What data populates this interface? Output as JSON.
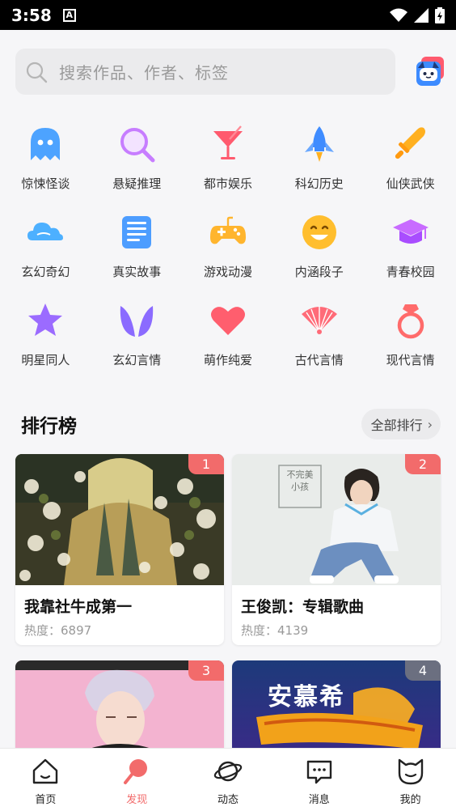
{
  "status_bar": {
    "time": "3:58",
    "notification_letter": "A"
  },
  "search": {
    "placeholder": "搜索作品、作者、标签"
  },
  "categories": [
    {
      "label": "惊悚怪谈",
      "icon": "ghost-icon",
      "color": "#4da3ff"
    },
    {
      "label": "悬疑推理",
      "icon": "magnifier-icon",
      "color": "#c77dff"
    },
    {
      "label": "都市娱乐",
      "icon": "cocktail-icon",
      "color": "#ff5a6e"
    },
    {
      "label": "科幻历史",
      "icon": "rocket-icon",
      "color": "#3f8cff"
    },
    {
      "label": "仙侠武侠",
      "icon": "sword-icon",
      "color": "#ffb020"
    },
    {
      "label": "玄幻奇幻",
      "icon": "cloud-icon",
      "color": "#4db0ff"
    },
    {
      "label": "真实故事",
      "icon": "newspaper-icon",
      "color": "#4d9dff"
    },
    {
      "label": "游戏动漫",
      "icon": "gamepad-icon",
      "color": "#ffb52e"
    },
    {
      "label": "内涵段子",
      "icon": "smiley-icon",
      "color": "#ffbe2e"
    },
    {
      "label": "青春校园",
      "icon": "graduation-cap-icon",
      "color": "#c86bff"
    },
    {
      "label": "明星同人",
      "icon": "star-icon",
      "color": "#9b6bff"
    },
    {
      "label": "玄幻言情",
      "icon": "wings-icon",
      "color": "#8b6bff"
    },
    {
      "label": "萌作纯爱",
      "icon": "heart-icon",
      "color": "#ff5e6e"
    },
    {
      "label": "古代言情",
      "icon": "folding-fan-icon",
      "color": "#ff6b78"
    },
    {
      "label": "现代言情",
      "icon": "ring-icon",
      "color": "#ff6b6b"
    }
  ],
  "ranking": {
    "title": "排行榜",
    "all_label": "全部排行",
    "items": [
      {
        "rank": "1",
        "title": "我靠社牛成第一",
        "heat": "热度：6897",
        "badge_color": "#f26b6b"
      },
      {
        "rank": "2",
        "title": "王俊凯：专辑歌曲",
        "heat": "热度：4139",
        "badge_color": "#f26b6b"
      },
      {
        "rank": "3",
        "title": "",
        "heat": "",
        "badge_color": "#f26b6b"
      },
      {
        "rank": "4",
        "title": "",
        "heat": "",
        "badge_color": "#6b6f80"
      }
    ],
    "card2_sign": [
      "不完美",
      "小孩"
    ],
    "card4_sign": "安慕希"
  },
  "bottom_nav": [
    {
      "label": "首页",
      "icon": "home-icon"
    },
    {
      "label": "发现",
      "icon": "discover-icon",
      "active": true
    },
    {
      "label": "动态",
      "icon": "planet-icon"
    },
    {
      "label": "消息",
      "icon": "message-icon"
    },
    {
      "label": "我的",
      "icon": "profile-icon"
    }
  ],
  "colors": {
    "accent": "#f26b6b",
    "background": "#f6f6f8"
  }
}
